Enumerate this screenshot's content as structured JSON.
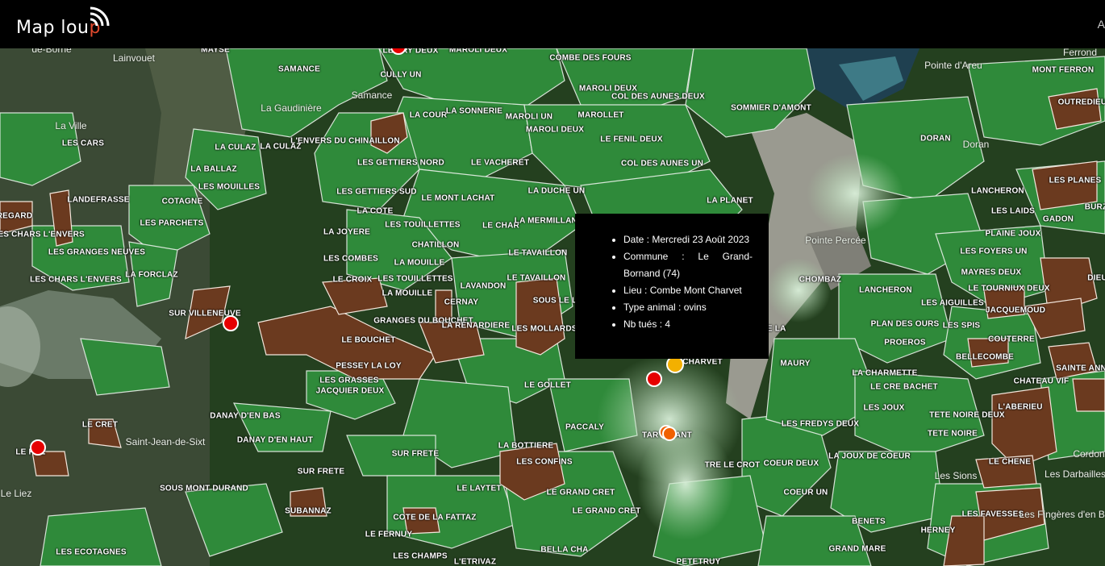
{
  "header": {
    "logo_text_a": "Map lou",
    "logo_text_b": "p",
    "right_text": "A"
  },
  "popup": {
    "items": [
      "Date : Mercredi 23 Août 2023",
      "Commune : Le Grand-Bornand (74)",
      "Lieu : Combe Mont Charvet",
      "Type animal : ovins",
      "Nb tués : 4"
    ]
  },
  "map": {
    "pasture_labels": [
      "MAYSE",
      "SAMANCE",
      "COMBE DES FOURS",
      "MAROLI DEUX",
      "MAROLI DEUX",
      "COL DES AUNES DEUX",
      "SOMMIER D'AMONT",
      "LA COUR",
      "LA SONNERIE",
      "MAROLI UN",
      "MAROLLET",
      "LE FENIL DEUX",
      "MAROLI DEUX",
      "L'ENVERS DU CHINAILLON",
      "LA CULAZ",
      "LA CULAZ",
      "LES GETTIERS NORD",
      "LE VACHERET",
      "COL DES AUNES UN",
      "DORAN",
      "LES CARS",
      "LA BALLAZ",
      "LES MOUILLES",
      "LES GETTIERS SUD",
      "LE MONT LACHAT",
      "LA DUCHE UN",
      "LA PLANET",
      "LANCHERON",
      "LANDEFRASSE",
      "COTAGNE",
      "LA COTE",
      "LES TOUILLETTES",
      "LE CHAR",
      "LA MERMILLANT",
      "LES LAIDS",
      "GADON",
      "LES PARCHETS",
      "LA JOYERE",
      "CHATILLON",
      "PLAINE JOUX",
      "LES CHARS L'ENVERS",
      "LES GRANGES NEUVES",
      "LES COMBES",
      "LA MOUILLE",
      "LE TAVAILLON",
      "LES PLANES",
      "LES FOYERS UN",
      "LA FORCLAZ",
      "LE CROIX",
      "LES TOUILLETTES",
      "LAVANDON",
      "LE TAVAILLON",
      "CHOMBAZ",
      "LANCHERON",
      "LES CHARS L'ENVERS",
      "LA MOUILLE",
      "CERNAY",
      "MAYRES DEUX",
      "LE TOURNIUX DEUX",
      "SUR VILLENEUVE",
      "GRANGES DU BOUCHET",
      "LA RENARDIERE",
      "LES MOLLARDS",
      "SOUS LE L",
      "LES AIGUILLES",
      "JACQUEMOUD",
      "LE BOUCHET",
      "PLAN DES OURS",
      "LES SPIS",
      "PROEROS",
      "COUTERRE",
      "BELLECOMBE",
      "SAINTE ANNE",
      "PESSEY LA LOY",
      "CHARVET",
      "MAURY",
      "LA CHARMETTE",
      "LE CRE BACHET",
      "CHATEAU VIF",
      "LES GRASSES",
      "JACQUIER DEUX",
      "LE GOLLET",
      "LES JOUX",
      "L'ABERIEU",
      "LE CRET",
      "DANAY D'EN BAS",
      "TETE NOIRE DEUX",
      "DANAY D'EN HAUT",
      "PACCALY",
      "LA BOTTIERE",
      "TARTARANT",
      "LES FREDYS DEUX",
      "TETE NOIRE",
      "LE PRE",
      "SUR FRETE",
      "LES CONFINS",
      "TRE LE CROT",
      "COEUR DEUX",
      "LA JOUX DE COEUR",
      "LE CHENE",
      "SUR FRETE",
      "SOUS MONT DURAND",
      "LE LAYTET",
      "LE GRAND CRET",
      "COEUR UN",
      "SUBANNAZ",
      "LE GRAND CRET",
      "COTE DE LA FATTAZ",
      "BENETS",
      "LES FAVESSES",
      "LE FERNUY",
      "HERNEY",
      "GRAND MARE",
      "LES ECOTAGNES",
      "LES CHAMPS",
      "L'ETRIVAZ",
      "BELLA CHA",
      "PETETRUY",
      "MONT FERRON",
      "OUTREDIEU",
      "REGARD",
      "DIEUX",
      "LE CRY DEUX",
      "CULLY UN",
      "DE LA",
      "BURZ"
    ],
    "place_names": [
      "La Gaudinière",
      "Samance",
      "La Ville",
      "Saint-Jean-de-Sixt",
      "Le Liez",
      "Pointe d'Areu",
      "Ferrond",
      "Doran",
      "Pointe Percée",
      "Les Sions",
      "Les Darbailles",
      "Cordon",
      "Les Fingères d'en Bas",
      "de-Borne",
      "Lainvouet"
    ],
    "markers": [
      {
        "name": "attack-marker",
        "color": "red"
      },
      {
        "name": "attack-marker",
        "color": "red"
      },
      {
        "name": "attack-marker",
        "color": "red"
      },
      {
        "name": "attack-marker",
        "color": "red"
      },
      {
        "name": "attack-marker",
        "color": "orange"
      },
      {
        "name": "attack-marker",
        "color": "orange"
      },
      {
        "name": "attack-marker",
        "color": "yellow"
      }
    ]
  },
  "colors": {
    "header_bg": "#000000",
    "pasture_green": "#2a7a32",
    "pasture_brown": "#6b3a1f",
    "marker_red": "#e60000",
    "marker_orange": "#f06000",
    "logo_accent": "#e0492d"
  }
}
